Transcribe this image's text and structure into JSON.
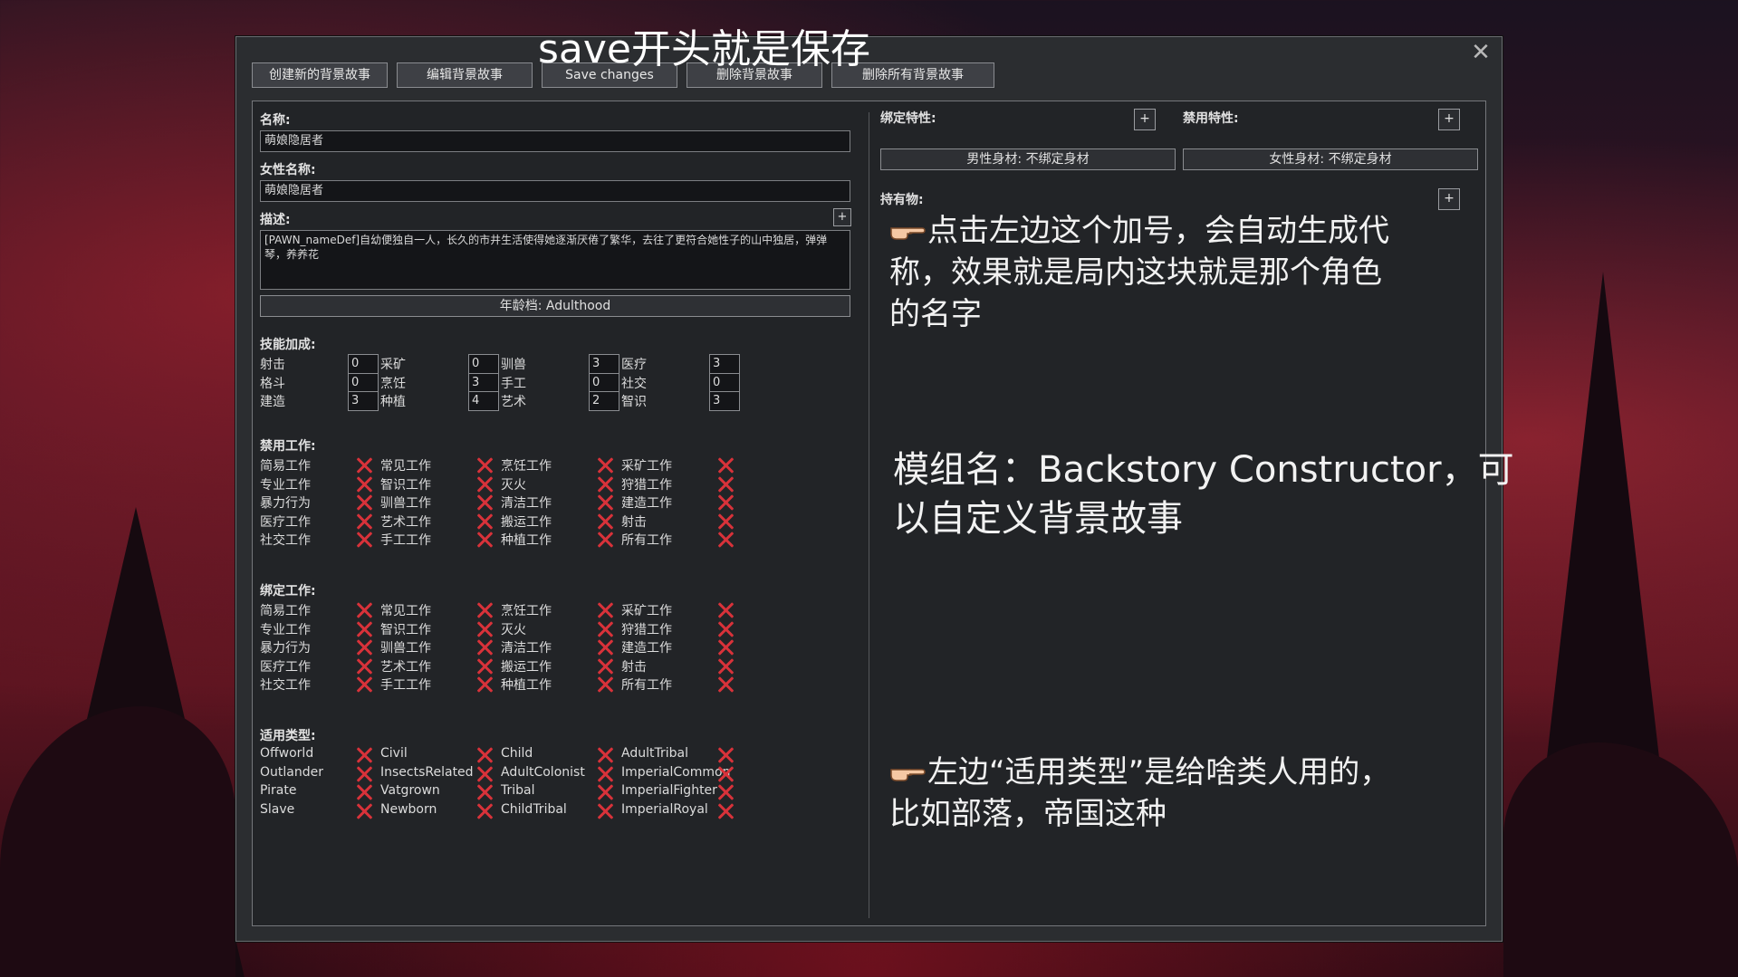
{
  "annotations": {
    "top": "save开头就是保存",
    "plus_hint": "点击左边这个加号，会自动生成代称，效果就是局内这块就是那个角色的名字",
    "plus_hint_lines": [
      "点击左边这个加号，会自动生成代",
      "称，效果就是局内这块就是那个角色",
      "的名字"
    ],
    "mod_name_lines": [
      "模组名：Backstory Constructor，可",
      "以自定义背景故事"
    ],
    "type_hint_lines": [
      "左边“适用类型”是给啥类人用的，",
      "比如部落，帝国这种"
    ]
  },
  "toolbar": {
    "create": "创建新的背景故事",
    "edit": "编辑背景故事",
    "save": "Save changes",
    "delete": "删除背景故事",
    "delete_all": "删除所有背景故事"
  },
  "form": {
    "name_label": "名称:",
    "name_value": "萌娘隐居者",
    "female_name_label": "女性名称:",
    "female_name_value": "萌娘隐居者",
    "desc_label": "描述:",
    "desc_value": "[PAWN_nameDef]自幼便独自一人，长久的市井生活使得她逐渐厌倦了繁华，去往了更符合她性子的山中独居，弹弹琴，养养花",
    "age_button": "年龄档: Adulthood"
  },
  "skills": {
    "label": "技能加成:",
    "items": [
      {
        "name": "射击",
        "value": "0"
      },
      {
        "name": "采矿",
        "value": "0"
      },
      {
        "name": "驯兽",
        "value": "3"
      },
      {
        "name": "医疗",
        "value": "3"
      },
      {
        "name": "格斗",
        "value": "0"
      },
      {
        "name": "烹饪",
        "value": "3"
      },
      {
        "name": "手工",
        "value": "0"
      },
      {
        "name": "社交",
        "value": "0"
      },
      {
        "name": "建造",
        "value": "3"
      },
      {
        "name": "种植",
        "value": "4"
      },
      {
        "name": "艺术",
        "value": "2"
      },
      {
        "name": "智识",
        "value": "3"
      }
    ]
  },
  "disabled_work": {
    "label": "禁用工作:",
    "items": [
      "简易工作",
      "常见工作",
      "烹饪工作",
      "采矿工作",
      "专业工作",
      "智识工作",
      "灭火",
      "狩猎工作",
      "暴力行为",
      "驯兽工作",
      "清洁工作",
      "建造工作",
      "医疗工作",
      "艺术工作",
      "搬运工作",
      "射击",
      "社交工作",
      "手工工作",
      "种植工作",
      "所有工作"
    ]
  },
  "required_work": {
    "label": "绑定工作:",
    "items": [
      "简易工作",
      "常见工作",
      "烹饪工作",
      "采矿工作",
      "专业工作",
      "智识工作",
      "灭火",
      "狩猎工作",
      "暴力行为",
      "驯兽工作",
      "清洁工作",
      "建造工作",
      "医疗工作",
      "艺术工作",
      "搬运工作",
      "射击",
      "社交工作",
      "手工工作",
      "种植工作",
      "所有工作"
    ]
  },
  "spawn_categories": {
    "label": "适用类型:",
    "items": [
      "Offworld",
      "Civil",
      "Child",
      "AdultTribal",
      "Outlander",
      "InsectsRelated",
      "AdultColonist",
      "ImperialCommon",
      "Pirate",
      "Vatgrown",
      "Tribal",
      "ImperialFighter",
      "Slave",
      "Newborn",
      "ChildTribal",
      "ImperialRoyal"
    ]
  },
  "right": {
    "forced_traits_label": "绑定特性:",
    "disallowed_traits_label": "禁用特性:",
    "male_body": "男性身材: 不绑定身材",
    "female_body": "女性身材: 不绑定身材",
    "possessions_label": "持有物:",
    "plus": "+"
  },
  "close_glyph": "✕",
  "colors": {
    "x_mark": "#d8323a",
    "window_bg": "#2b2d30",
    "panel_bg": "#222427"
  }
}
